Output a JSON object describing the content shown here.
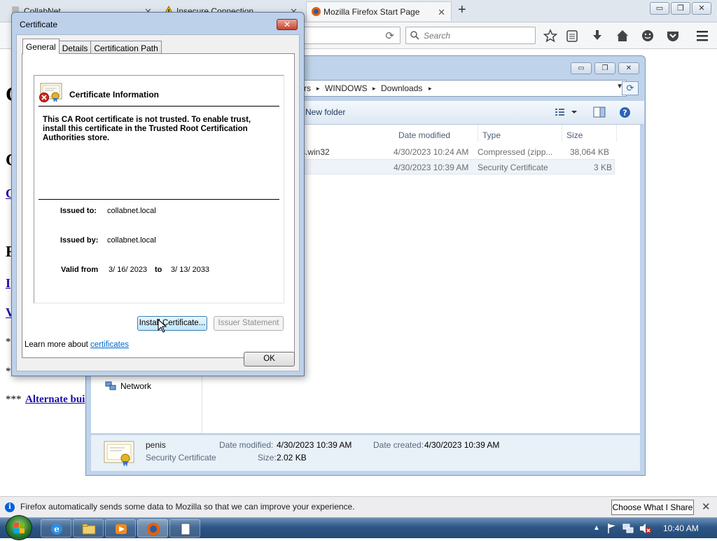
{
  "firefox": {
    "tabs": [
      {
        "label": "CollabNet",
        "active": false
      },
      {
        "label": "Insecure Connection",
        "active": false
      },
      {
        "label": "Mozilla Firefox Start Page",
        "active": true
      }
    ],
    "new_tab": "+",
    "window_buttons": {
      "minimize": "▭",
      "restore": "❐",
      "close": "✕"
    },
    "search_placeholder": "Search",
    "notification": {
      "text": "Firefox automatically sends some data to Mozilla so that we can improve your experience.",
      "button": "Choose What I Share",
      "close": "✕"
    }
  },
  "webpage": {
    "fragments": [
      "C",
      "C",
      "C",
      "F",
      "I",
      "V",
      "*",
      "*",
      "***"
    ],
    "alt_link": "Alternate bui"
  },
  "explorer": {
    "breadcrumbs": [
      "rs",
      "WINDOWS",
      "Downloads"
    ],
    "breadcrumb_sep": "▸",
    "new_folder": "New folder",
    "columns": [
      "Date modified",
      "Type",
      "Size"
    ],
    "files": [
      {
        "name": "s.win32",
        "date": "4/30/2023 10:24 AM",
        "type": "Compressed (zipp...",
        "size": "38,064 KB"
      },
      {
        "name": "",
        "date": "4/30/2023 10:39 AM",
        "type": "Security Certificate",
        "size": "3 KB"
      }
    ],
    "nav_network": "Network",
    "details": {
      "name": "penis",
      "type": "Security Certificate",
      "date_modified_label": "Date modified:",
      "date_modified": "4/30/2023 10:39 AM",
      "date_created_label": "Date created:",
      "date_created": "4/30/2023 10:39 AM",
      "size_label": "Size:",
      "size": "2.02 KB"
    }
  },
  "certificate": {
    "title": "Certificate",
    "close": "✕",
    "tabs": [
      "General",
      "Details",
      "Certification Path"
    ],
    "info_title": "Certificate Information",
    "message": "This CA Root certificate is not trusted. To enable trust, install this certificate in the Trusted Root Certification Authorities store.",
    "issued_to_label": "Issued to:",
    "issued_to": "collabnet.local",
    "issued_by_label": "Issued by:",
    "issued_by": "collabnet.local",
    "valid_from_label": "Valid from",
    "valid_from": "3/ 16/ 2023",
    "valid_to_label": "to",
    "valid_to": "3/ 13/ 2033",
    "install_button": "Install Certificate...",
    "issuer_button": "Issuer Statement",
    "learn_prefix": "Learn more about",
    "learn_link": "certificates",
    "ok_button": "OK"
  },
  "taskbar": {
    "clock": "10:40 AM"
  }
}
